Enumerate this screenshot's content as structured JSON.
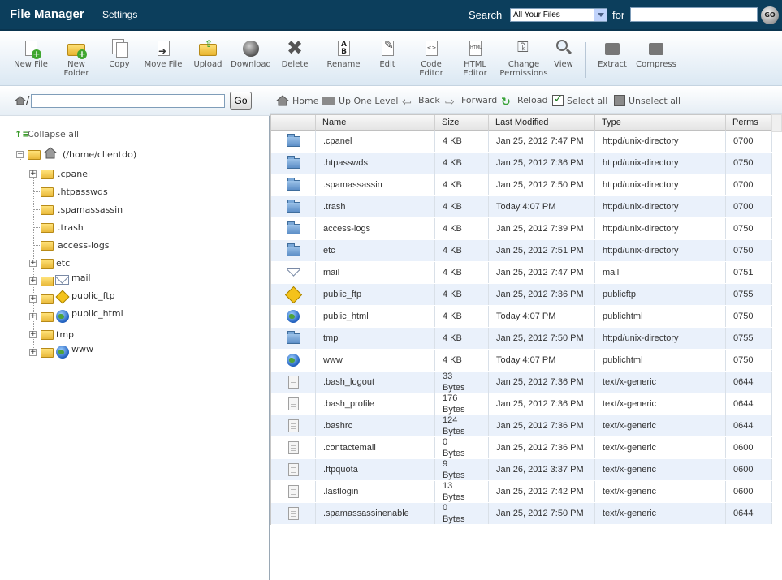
{
  "header": {
    "title": "File Manager",
    "settings_label": "Settings",
    "search_label": "Search",
    "search_scope": "All Your Files",
    "for_label": "for",
    "for_value": "",
    "go_label": "GO"
  },
  "toolbar": {
    "items": [
      {
        "label": "New File",
        "icon": "new-file-icon"
      },
      {
        "label": "New Folder",
        "icon": "new-folder-icon"
      },
      {
        "label": "Copy",
        "icon": "copy-icon"
      },
      {
        "label": "Move File",
        "icon": "move-file-icon"
      },
      {
        "label": "Upload",
        "icon": "upload-icon"
      },
      {
        "label": "Download",
        "icon": "download-icon"
      },
      {
        "label": "Delete",
        "icon": "delete-icon"
      },
      {
        "label": "Rename",
        "icon": "rename-icon"
      },
      {
        "label": "Edit",
        "icon": "edit-icon"
      },
      {
        "label": "Code Editor",
        "icon": "code-editor-icon"
      },
      {
        "label": "HTML Editor",
        "icon": "html-editor-icon"
      },
      {
        "label": "Change Permissions",
        "icon": "permissions-icon"
      },
      {
        "label": "View",
        "icon": "view-icon"
      },
      {
        "label": "Extract",
        "icon": "extract-icon"
      },
      {
        "label": "Compress",
        "icon": "compress-icon"
      }
    ]
  },
  "left": {
    "path_slash": "/",
    "path_value": "",
    "go_label": "Go",
    "collapse_label": "Collapse all",
    "tree": {
      "root": "(/home/clientdo)",
      "items": [
        ".cpanel",
        ".htpasswds",
        ".spamassassin",
        ".trash",
        "access-logs",
        "etc",
        "mail",
        "public_ftp",
        "public_html",
        "tmp",
        "www"
      ]
    }
  },
  "nav": {
    "home": "Home",
    "up": "Up One Level",
    "back": "Back",
    "forward": "Forward",
    "reload": "Reload",
    "select_all": "Select all",
    "unselect_all": "Unselect all"
  },
  "table": {
    "headers": {
      "name": "Name",
      "size": "Size",
      "modified": "Last Modified",
      "type": "Type",
      "perms": "Perms"
    },
    "rows": [
      {
        "icon": "folder",
        "name": ".cpanel",
        "size": "4 KB",
        "modified": "Jan 25, 2012 7:47 PM",
        "type": "httpd/unix-directory",
        "perms": "0700"
      },
      {
        "icon": "folder",
        "name": ".htpasswds",
        "size": "4 KB",
        "modified": "Jan 25, 2012 7:36 PM",
        "type": "httpd/unix-directory",
        "perms": "0750"
      },
      {
        "icon": "folder",
        "name": ".spamassassin",
        "size": "4 KB",
        "modified": "Jan 25, 2012 7:50 PM",
        "type": "httpd/unix-directory",
        "perms": "0700"
      },
      {
        "icon": "folder",
        "name": ".trash",
        "size": "4 KB",
        "modified": "Today 4:07 PM",
        "type": "httpd/unix-directory",
        "perms": "0700"
      },
      {
        "icon": "folder",
        "name": "access-logs",
        "size": "4 KB",
        "modified": "Jan 25, 2012 7:39 PM",
        "type": "httpd/unix-directory",
        "perms": "0750"
      },
      {
        "icon": "folder",
        "name": "etc",
        "size": "4 KB",
        "modified": "Jan 25, 2012 7:51 PM",
        "type": "httpd/unix-directory",
        "perms": "0750"
      },
      {
        "icon": "mail",
        "name": "mail",
        "size": "4 KB",
        "modified": "Jan 25, 2012 7:47 PM",
        "type": "mail",
        "perms": "0751"
      },
      {
        "icon": "ftp",
        "name": "public_ftp",
        "size": "4 KB",
        "modified": "Jan 25, 2012 7:36 PM",
        "type": "publicftp",
        "perms": "0755"
      },
      {
        "icon": "globe",
        "name": "public_html",
        "size": "4 KB",
        "modified": "Today 4:07 PM",
        "type": "publichtml",
        "perms": "0750"
      },
      {
        "icon": "folder",
        "name": "tmp",
        "size": "4 KB",
        "modified": "Jan 25, 2012 7:50 PM",
        "type": "httpd/unix-directory",
        "perms": "0755"
      },
      {
        "icon": "globe",
        "name": "www",
        "size": "4 KB",
        "modified": "Today 4:07 PM",
        "type": "publichtml",
        "perms": "0750"
      },
      {
        "icon": "doc",
        "name": ".bash_logout",
        "size": "33 Bytes",
        "modified": "Jan 25, 2012 7:36 PM",
        "type": "text/x-generic",
        "perms": "0644"
      },
      {
        "icon": "doc",
        "name": ".bash_profile",
        "size": "176 Bytes",
        "modified": "Jan 25, 2012 7:36 PM",
        "type": "text/x-generic",
        "perms": "0644"
      },
      {
        "icon": "doc",
        "name": ".bashrc",
        "size": "124 Bytes",
        "modified": "Jan 25, 2012 7:36 PM",
        "type": "text/x-generic",
        "perms": "0644"
      },
      {
        "icon": "doc",
        "name": ".contactemail",
        "size": "0 Bytes",
        "modified": "Jan 25, 2012 7:36 PM",
        "type": "text/x-generic",
        "perms": "0600"
      },
      {
        "icon": "doc",
        "name": ".ftpquota",
        "size": "9 Bytes",
        "modified": "Jan 26, 2012 3:37 PM",
        "type": "text/x-generic",
        "perms": "0600"
      },
      {
        "icon": "doc",
        "name": ".lastlogin",
        "size": "13 Bytes",
        "modified": "Jan 25, 2012 7:42 PM",
        "type": "text/x-generic",
        "perms": "0600"
      },
      {
        "icon": "doc",
        "name": ".spamassassinenable",
        "size": "0 Bytes",
        "modified": "Jan 25, 2012 7:50 PM",
        "type": "text/x-generic",
        "perms": "0644"
      }
    ]
  }
}
